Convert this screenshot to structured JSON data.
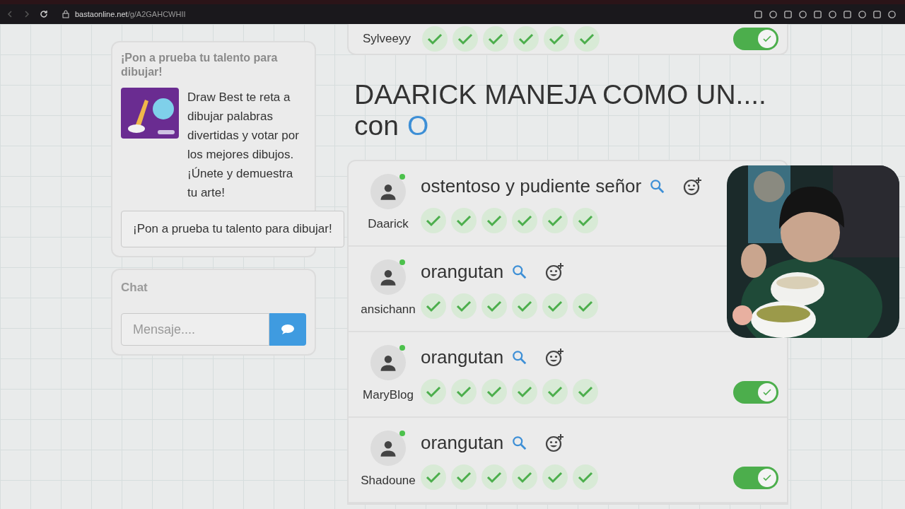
{
  "browser": {
    "url_host": "bastaonline.net",
    "url_path": "/g/A2GAHCWHII"
  },
  "promo": {
    "title": "¡Pon a prueba tu talento para dibujar!",
    "text": "Draw Best te reta a dibujar palabras divertidas y votar por los mejores dibujos. ¡Únete y demuestra tu arte!",
    "button": "¡Pon a prueba tu talento para dibujar!"
  },
  "chat": {
    "title": "Chat",
    "placeholder": "Mensaje...."
  },
  "previous_answer": {
    "player": "Sylveeyy",
    "checks": [
      {
        "checked": true
      },
      {
        "checked": true
      },
      {
        "checked": true
      },
      {
        "checked": true
      },
      {
        "checked": true
      },
      {
        "checked": true
      }
    ],
    "toggle": {
      "on": true
    }
  },
  "category": {
    "title": "DAARICK MANEJA COMO UN....",
    "connector": "con",
    "letter": "O"
  },
  "answers": [
    {
      "player": "Daarick",
      "online": true,
      "answer": "ostentoso y pudiente señor",
      "checks": [
        {
          "checked": true
        },
        {
          "checked": true
        },
        {
          "checked": true
        },
        {
          "checked": true
        },
        {
          "checked": true
        },
        {
          "checked": true
        }
      ]
    },
    {
      "player": "ansichann",
      "online": true,
      "answer": "orangutan",
      "checks": [
        {
          "checked": true
        },
        {
          "checked": true
        },
        {
          "checked": true
        },
        {
          "checked": true
        },
        {
          "checked": true
        },
        {
          "checked": true
        }
      ]
    },
    {
      "player": "MaryBlog",
      "online": true,
      "answer": "orangutan",
      "checks": [
        {
          "checked": true
        },
        {
          "checked": true
        },
        {
          "checked": true
        },
        {
          "checked": true
        },
        {
          "checked": true
        },
        {
          "checked": true
        }
      ],
      "toggle": {
        "on": true
      }
    },
    {
      "player": "Shadoune",
      "online": true,
      "answer": "orangutan",
      "checks": [
        {
          "checked": true
        },
        {
          "checked": true
        },
        {
          "checked": true
        },
        {
          "checked": true
        },
        {
          "checked": true
        },
        {
          "checked": true
        }
      ],
      "toggle": {
        "on": true
      }
    }
  ]
}
